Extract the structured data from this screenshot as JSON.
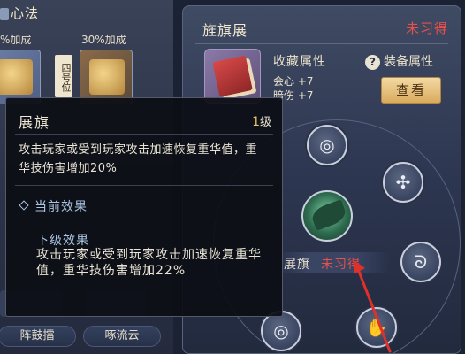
{
  "left_panel": {
    "title": "心法",
    "bonus_left": "%加成",
    "bonus_right": "30%加成",
    "slot_tag": "四号位",
    "bottom_buttons": [
      "阵鼓擂",
      "啄流云"
    ]
  },
  "banner": {
    "title": "旌旗展",
    "status": "未习得",
    "collect_label": "收藏属性",
    "stats": [
      "会心 +7",
      "暗伤 +7"
    ],
    "equip_label": "装备属性",
    "view_button": "查看"
  },
  "ring": {
    "center_name": "展旗",
    "center_status": "未习得",
    "node_icons": [
      "eye-rune-icon",
      "knot-rune-icon",
      "spiral-rune-icon",
      "hand-rune-icon",
      "eye-rune-icon",
      "eye-rune-icon"
    ]
  },
  "tooltip": {
    "title": "展旗",
    "level_num": "1",
    "level_unit": "级",
    "description": "攻击玩家或受到玩家攻击加速恢复重华值，重华技伤害增加20%",
    "current_effect_label": "当前效果",
    "next_effect_title": "下级效果",
    "next_effect_desc": "攻击玩家或受到玩家攻击加速恢复重华值，重华技伤害增加22%"
  },
  "colors": {
    "status_red": "#e8504c",
    "level_gold": "#e7c465",
    "view_button_gold": "#d9aa5e",
    "effect_blue": "#a9c4e2"
  }
}
